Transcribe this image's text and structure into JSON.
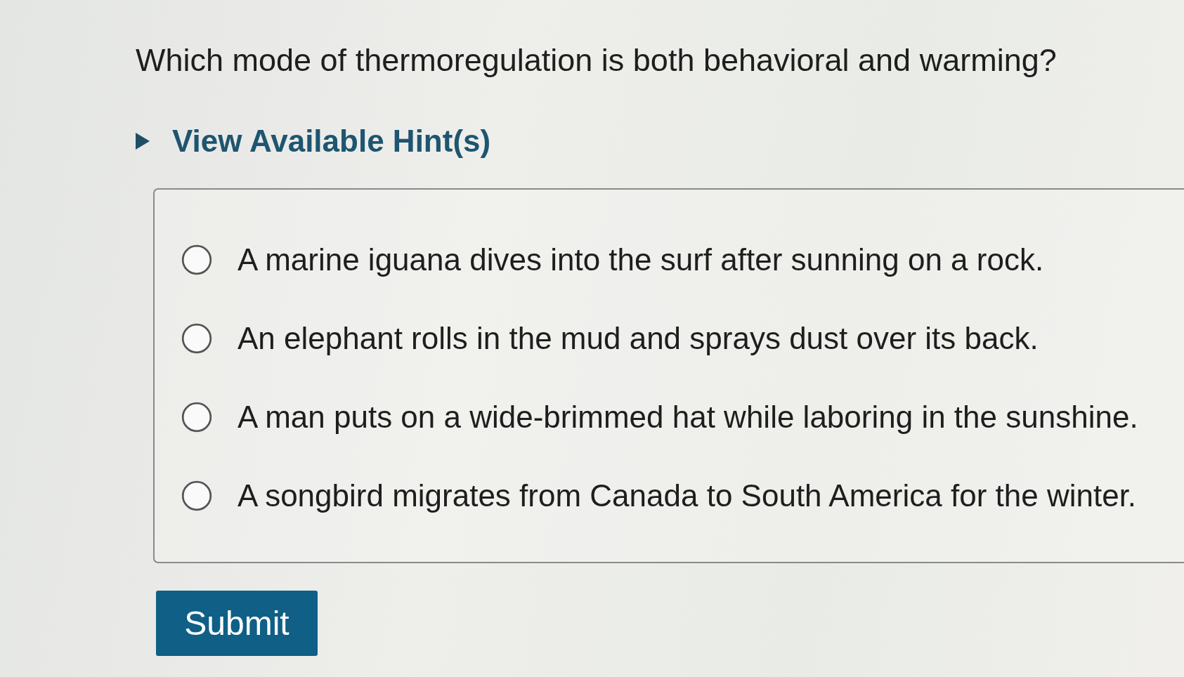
{
  "question": {
    "text": "Which mode of thermoregulation is both behavioral and warming?"
  },
  "hint": {
    "label": "View Available Hint(s)",
    "expanded": false
  },
  "options": [
    {
      "text": "A marine iguana dives into the surf after sunning on a rock.",
      "selected": false
    },
    {
      "text": "An elephant rolls in the mud and sprays dust over its back.",
      "selected": false
    },
    {
      "text": "A man puts on a wide-brimmed hat while laboring in the sunshine.",
      "selected": false
    },
    {
      "text": "A songbird migrates from Canada to South America for the winter.",
      "selected": false
    }
  ],
  "submit": {
    "label": "Submit"
  }
}
